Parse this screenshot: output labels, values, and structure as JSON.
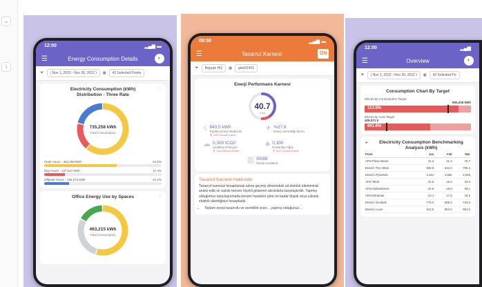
{
  "left_edge": {
    "chip_top": "⌄",
    "chip_mid": "›"
  },
  "colors": {
    "purple": "#6c63c7",
    "orange": "#ec7a3a",
    "yellow": "#f5c842",
    "green": "#4aa64c",
    "red": "#e85a5a",
    "blue": "#4a7bd0",
    "gray": "#cfd3d6"
  },
  "screen1": {
    "time": "12:00",
    "title": "Energy Consumption Details",
    "date_range": "( Nov 1, 2022 - Nov 30, 2022 )",
    "selected_points": "42 Selected Points",
    "chart1": {
      "title_line1": "Electricity Consumption (kWh)",
      "title_line2": "Distribution - Three Rate",
      "center_value": "735,258 kWh",
      "center_label": "Total Consumption",
      "legend": [
        {
          "label": "Peak Hours - 452,258 kWh",
          "pct": "61.5%",
          "color": "#f5c842",
          "fill": 0.615
        },
        {
          "label": "Day Hours - 127,647 kWh",
          "pct": "17.4%",
          "color": "#e85a5a",
          "fill": 0.174
        },
        {
          "label": "Offpeak Hours - 155,373 kWh",
          "pct": "21.2%",
          "color": "#4a7bd0",
          "fill": 0.212
        }
      ],
      "segments": [
        0.615,
        0.174,
        0.212
      ]
    },
    "chart2": {
      "title": "Office Energy Use by Spaces",
      "center_value": "463,215 kWh",
      "center_label": "Total Consumption",
      "segments": [
        0.55,
        0.28,
        0.17
      ]
    }
  },
  "screen2": {
    "time": "09:58",
    "title": "Tasarruf Karnesi",
    "logo": "ON",
    "filter_a": "Bayşan HQ",
    "filter_b": "gdız51401",
    "card_title": "Enerji Performans Karnesi",
    "gauge_value": "40.7",
    "gauge_label": "Dolu",
    "gauge_fraction": 0.407,
    "metrics": [
      {
        "icon": "☇",
        "value": "843,5 kWh",
        "label": "Toplam Enerji Tasarrufu",
        "trend": "▼ %23  Önceki Karne"
      },
      {
        "icon": "✈",
        "value": "%27,6",
        "label": "Enerji Verimliliği Skoru",
        "trend": ""
      },
      {
        "icon": "☁",
        "value": "0,300 tCO2",
        "label": "Azaltılan Emisyon",
        "trend": "▼ %12  Önceki Karne"
      },
      {
        "icon": "♣",
        "value": "0,300",
        "label": "Kurtarılan Ağaç",
        "trend": "▼ %12  Önceki Karne"
      }
    ],
    "center_metric": {
      "icon": "▥",
      "value": "50/88",
      "label": "Genel Sıralama"
    },
    "about_title": "Tasarruf Karnesi Hakkında",
    "about_text": "Tasarruf karnesiz hesaplamak adına geçmiş dönemdeki ait elektrik tüketiminizi analiz edib ve sizinle benzer ölçekli gösteren akranlarla karşılaştırdık. Yapmış olduğumuz karşılaştırmada benzer hanelere göre ne kadar düşük veya yüksek elektrik tüketti̇ğinizi hesapladık.",
    "about_bullet": "Toplam enerji tasarrufu ve verimlilik oranı ...yapmış olduğunuz..."
  },
  "screen3": {
    "time": "12:00",
    "title": "Overview",
    "date_range": "( Nov 1, 2022 - Nov 30, 2022 )",
    "selected_points": "42 Selected Po",
    "target_card": {
      "title": "Consumption Chart By Target",
      "t1_label": "Electricity Consumption Target",
      "t1_value": "600,218 kWh",
      "t1_pct": "113.6%",
      "t1_fill": 0.88,
      "t1_mark": 0.78,
      "t2_label": "Electricity Cost Target",
      "t2_value": "429,371 $",
      "t2_pct": "661.6%",
      "t2_fill": 0.62,
      "t2_mark": 0.2
    },
    "bench_card": {
      "title_line1": "Electricity Consumption Benchmarking",
      "title_line2": "Analysis (kWh)",
      "headers": [
        "Point",
        "Jan",
        "Feb",
        "Mar"
      ],
      "rows": [
        [
          "ATM Plaza Meser",
          "31.2",
          "31.3",
          "70.7"
        ],
        [
          "Branch The Hilton",
          "836.5",
          "542.0",
          "706.4"
        ],
        [
          "Branch Pyramids",
          "2,451",
          "1,566",
          "2,045"
        ],
        [
          "ATM Tahrir",
          "21.5",
          "15.2",
          "18.0"
        ],
        [
          "ATM Sultanahmet",
          "22.9",
          "18.0",
          "28.1"
        ],
        [
          "ATM Ehramlar",
          "23.1",
          "17.0",
          "18.5"
        ],
        [
          "Branch İzmirkah",
          "775.0",
          "588.1",
          "723.0"
        ],
        [
          "Branch Luxor",
          "912.5",
          "904.0",
          "804.0"
        ]
      ]
    }
  }
}
